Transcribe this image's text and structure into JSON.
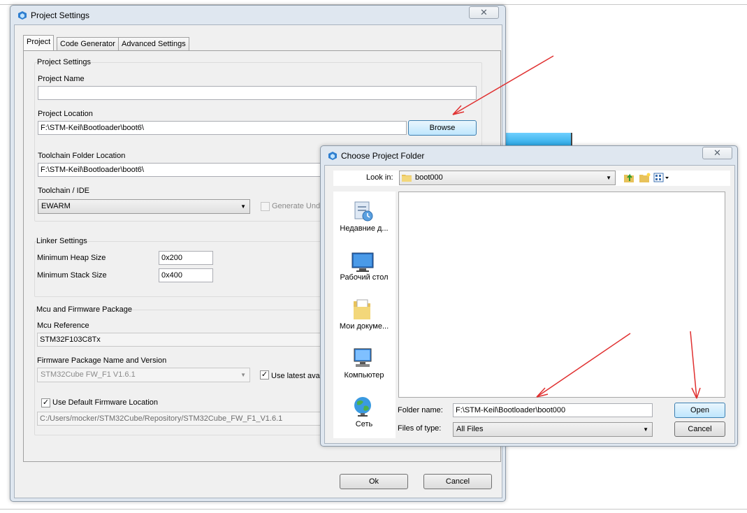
{
  "project_settings_dialog": {
    "title": "Project Settings",
    "close_glyph": "✕",
    "tabs": [
      "Project",
      "Code Generator",
      "Advanced Settings"
    ],
    "project_group_title": "Project Settings",
    "project_name_label": "Project Name",
    "project_name_value": "",
    "project_location_label": "Project Location",
    "project_location_value": "F:\\STM-Keil\\Bootloader\\boot6\\",
    "browse_label": "Browse",
    "toolchain_folder_label": "Toolchain Folder Location",
    "toolchain_folder_value": "F:\\STM-Keil\\Bootloader\\boot6\\",
    "toolchain_ide_label": "Toolchain / IDE",
    "toolchain_ide_value": "EWARM",
    "generate_under_root_label": "Generate Unde",
    "linker_title": "Linker Settings",
    "min_heap_label": "Minimum Heap Size",
    "min_heap_value": "0x200",
    "min_stack_label": "Minimum Stack Size",
    "min_stack_value": "0x400",
    "mcu_firmware_title": "Mcu and Firmware Package",
    "mcu_reference_label": "Mcu Reference",
    "mcu_reference_value": "STM32F103C8Tx",
    "firmware_package_label": "Firmware Package Name and Version",
    "firmware_package_value": "STM32Cube FW_F1 V1.6.1",
    "use_latest_label": "Use latest ava",
    "use_latest_checked": true,
    "use_default_fw_label": "Use Default Firmware Location",
    "use_default_fw_checked": true,
    "firmware_location_value": "C:/Users/mocker/STM32Cube/Repository/STM32Cube_FW_F1_V1.6.1",
    "ok_label": "Ok",
    "cancel_label": "Cancel"
  },
  "choose_folder_dialog": {
    "title": "Choose Project Folder",
    "close_glyph": "✕",
    "look_in_label": "Look in:",
    "look_in_value": "boot000",
    "toolbar_icons": [
      "up-folder-icon",
      "new-folder-icon",
      "view-menu-icon"
    ],
    "places": [
      {
        "label": "Недавние д...",
        "icon": "recent-places-icon"
      },
      {
        "label": "Рабочий стол",
        "icon": "desktop-icon"
      },
      {
        "label": "Мои докуме...",
        "icon": "my-documents-icon"
      },
      {
        "label": "Компьютер",
        "icon": "computer-icon"
      },
      {
        "label": "Сеть",
        "icon": "network-icon"
      }
    ],
    "folder_name_label": "Folder name:",
    "folder_name_value": "F:\\STM-Keil\\Bootloader\\boot000",
    "files_of_type_label": "Files of type:",
    "files_of_type_value": "All Files",
    "open_label": "Open",
    "cancel_label": "Cancel"
  },
  "colors": {
    "annotation_arrow": "#e03030",
    "highlight_strip": "#1ea0e0"
  }
}
